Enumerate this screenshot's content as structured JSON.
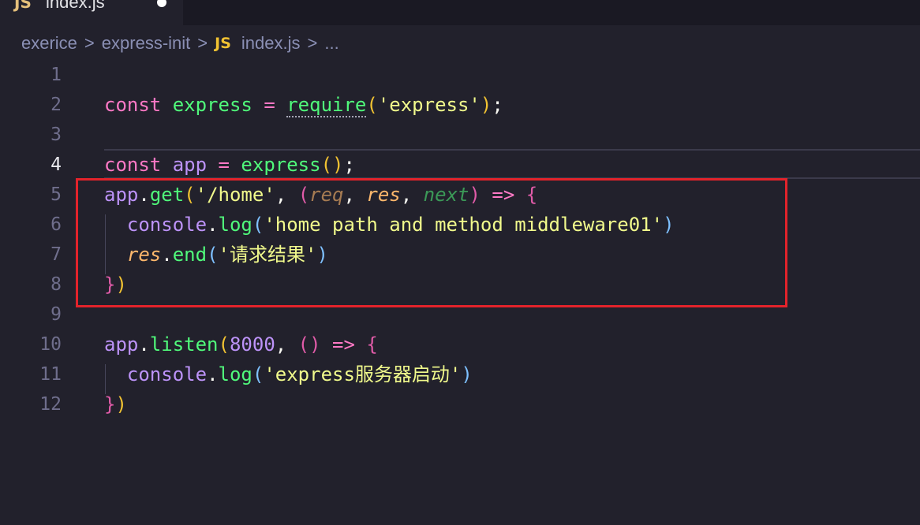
{
  "tab": {
    "badge": "JS",
    "title": "index.js"
  },
  "breadcrumb": {
    "folder1": "exerice",
    "folder2": "express-init",
    "file_badge": "JS",
    "file": "index.js",
    "symbol": "...",
    "separator": ">"
  },
  "editor": {
    "active_line": 4,
    "line_numbers": [
      "1",
      "2",
      "3",
      "4",
      "5",
      "6",
      "7",
      "8",
      "9",
      "10",
      "11",
      "12"
    ],
    "lines": [
      "",
      "const express = require('express');",
      "",
      "const app = express();",
      "app.get('/home', (req, res, next) => {",
      "  console.log('home path and method middleware01')",
      "  res.end('请求结果')",
      "})",
      "",
      "app.listen(8000, () => {",
      "  console.log('express服务器启动')",
      "})"
    ]
  },
  "colors": {
    "background": "#22212c",
    "keyword": "#ff79c6",
    "function": "#50fa7b",
    "variable": "#bd93f9",
    "string": "#f1fa8c",
    "parameter": "#ffb86c",
    "highlight_box": "#e3232b"
  },
  "icons": {
    "js_file": "js-file-icon",
    "unsaved": "unsaved-dot-icon"
  }
}
